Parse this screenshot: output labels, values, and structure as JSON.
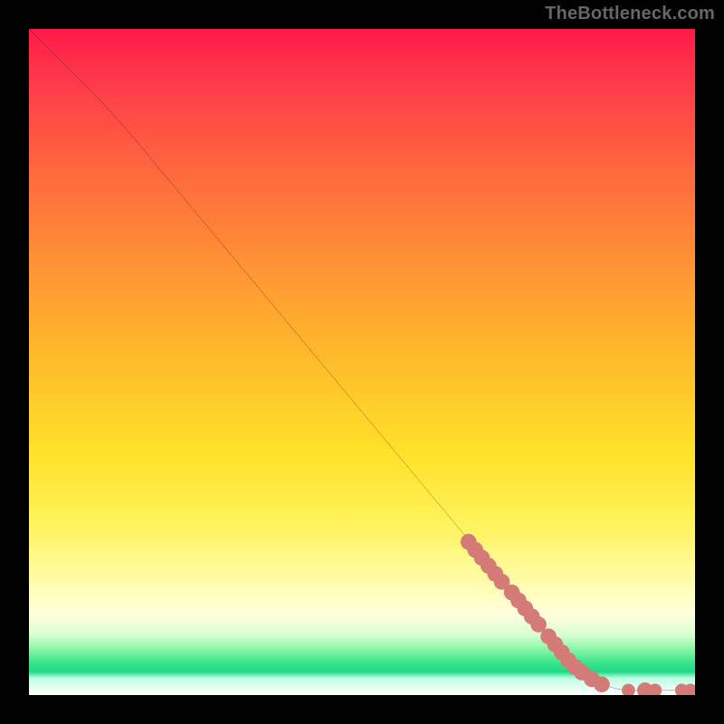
{
  "watermark": "TheBottleneck.com",
  "colors": {
    "curve": "#000000",
    "marker_fill": "#d47b78",
    "marker_stroke": "#d47b78",
    "background_black": "#000000"
  },
  "chart_data": {
    "type": "line",
    "title": "",
    "xlabel": "",
    "ylabel": "",
    "xlim": [
      0,
      100
    ],
    "ylim": [
      0,
      100
    ],
    "grid": false,
    "legend": false,
    "series": [
      {
        "name": "curve",
        "x": [
          0,
          3,
          6,
          10,
          15,
          20,
          25,
          30,
          35,
          40,
          45,
          50,
          55,
          60,
          65,
          70,
          75,
          80,
          82,
          84,
          86,
          88,
          90,
          92,
          94,
          96,
          98,
          100
        ],
        "y": [
          100,
          97,
          94,
          90,
          84.5,
          78.5,
          72.5,
          66.5,
          60.5,
          54.5,
          48.5,
          42.5,
          36.5,
          30.5,
          24.5,
          18.5,
          12.5,
          6.5,
          4.5,
          3.0,
          1.8,
          1.0,
          0.7,
          0.7,
          0.7,
          0.7,
          0.7,
          0.7
        ]
      }
    ],
    "markers": [
      {
        "x": 66,
        "y": 23.0,
        "r": 1.2
      },
      {
        "x": 67,
        "y": 21.8,
        "r": 1.2
      },
      {
        "x": 68,
        "y": 20.6,
        "r": 1.2
      },
      {
        "x": 69,
        "y": 19.4,
        "r": 1.2
      },
      {
        "x": 70,
        "y": 18.2,
        "r": 1.2
      },
      {
        "x": 71,
        "y": 17.0,
        "r": 1.2
      },
      {
        "x": 72.5,
        "y": 15.4,
        "r": 1.2
      },
      {
        "x": 73.5,
        "y": 14.2,
        "r": 1.2
      },
      {
        "x": 74.5,
        "y": 13.0,
        "r": 1.2
      },
      {
        "x": 75.5,
        "y": 11.8,
        "r": 1.2
      },
      {
        "x": 76.5,
        "y": 10.6,
        "r": 1.2
      },
      {
        "x": 78,
        "y": 8.8,
        "r": 1.2
      },
      {
        "x": 79,
        "y": 7.6,
        "r": 1.2
      },
      {
        "x": 80,
        "y": 6.4,
        "r": 1.2
      },
      {
        "x": 81,
        "y": 5.2,
        "r": 1.2
      },
      {
        "x": 82,
        "y": 4.2,
        "r": 1.2
      },
      {
        "x": 83,
        "y": 3.4,
        "r": 1.2
      },
      {
        "x": 84.5,
        "y": 2.4,
        "r": 1.2
      },
      {
        "x": 86,
        "y": 1.6,
        "r": 1.2
      },
      {
        "x": 90,
        "y": 0.7,
        "r": 1.0
      },
      {
        "x": 92.5,
        "y": 0.7,
        "r": 1.2
      },
      {
        "x": 94,
        "y": 0.7,
        "r": 1.0
      },
      {
        "x": 98,
        "y": 0.7,
        "r": 1.0
      },
      {
        "x": 99.3,
        "y": 0.7,
        "r": 1.0
      }
    ]
  }
}
